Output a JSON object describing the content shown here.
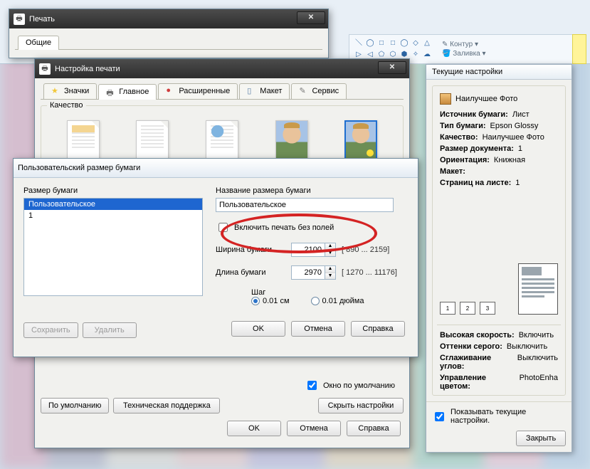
{
  "print_dialog": {
    "title": "Печать",
    "tab_general": "Общие"
  },
  "setup_dialog": {
    "title": "Настройка печати",
    "tabs": {
      "icons": "Значки",
      "main": "Главное",
      "advanced": "Расширенные",
      "layout": "Макет",
      "service": "Сервис"
    },
    "quality_label": "Качество",
    "default_window_label": "Окно по умолчанию",
    "buttons": {
      "defaults": "По умолчанию",
      "support": "Техническая поддержка",
      "hide": "Скрыть настройки",
      "ok": "OK",
      "cancel": "Отмена",
      "help": "Справка"
    }
  },
  "paper_dialog": {
    "title": "Пользовательский размер бумаги",
    "size_list_label": "Размер бумаги",
    "name_label": "Название размера бумаги",
    "items": [
      {
        "label": "Пользовательское",
        "selected": true
      },
      {
        "label": "1",
        "selected": false
      }
    ],
    "name_value": "Пользовательское",
    "borderless_label": "Включить печать без полей",
    "borderless_checked": false,
    "width_label": "Ширина бумаги",
    "width_value": "2100",
    "width_range": "[   890 ... 2159]",
    "height_label": "Длина бумаги",
    "height_value": "2970",
    "height_range": "[ 1270 ... 11176]",
    "step_label": "Шаг",
    "step_cm": "0.01 см",
    "step_inch": "0.01 дюйма",
    "buttons": {
      "save": "Сохранить",
      "delete": "Удалить",
      "ok": "OK",
      "cancel": "Отмена",
      "help": "Справка"
    }
  },
  "info_panel": {
    "title": "Текущие настройки",
    "profile": "Наилучшее Фото",
    "kv": {
      "source_k": "Источник бумаги:",
      "source_v": "Лист",
      "type_k": "Тип бумаги:",
      "type_v": "Epson Glossy",
      "quality_k": "Качество:",
      "quality_v": "Наилучшее Фото",
      "docsize_k": "Размер документа:",
      "docsize_v": "1",
      "orient_k": "Ориентация:",
      "orient_v": "Книжная",
      "layout_k": "Макет:",
      "layout_v": "",
      "pps_k": "Страниц на листе:",
      "pps_v": "1",
      "speed_k": "Высокая скорость:",
      "speed_v": "Включить",
      "gray_k": "Оттенки серого:",
      "gray_v": "Выключить",
      "smooth_k": "Сглаживание углов:",
      "smooth_v": "Выключить",
      "color_k": "Управление цветом:",
      "color_v": "PhotoEnha"
    },
    "env_labels": [
      "1",
      "2",
      "3"
    ],
    "show_label": "Показывать текущие настройки.",
    "close": "Закрыть"
  },
  "ribbon": {
    "outline": "Контур",
    "fill": "Заливка"
  }
}
